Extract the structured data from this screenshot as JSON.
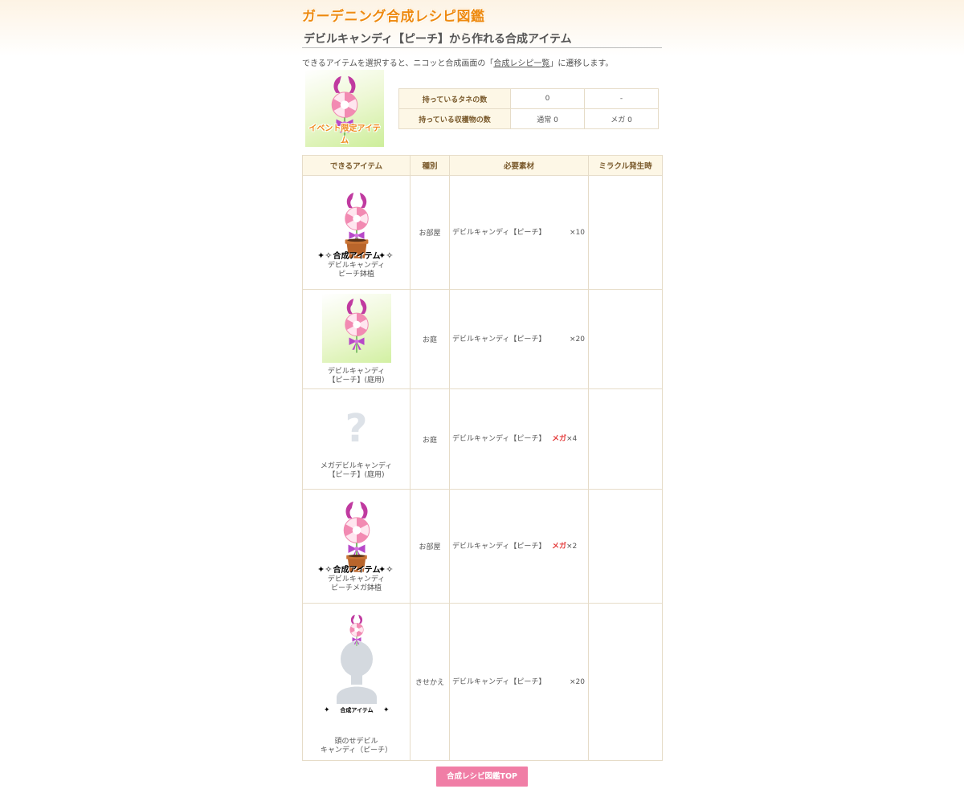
{
  "header": {
    "logo": "ガーデニング合成レシピ図鑑",
    "title": "デビルキャンディ【ピーチ】から作れる合成アイテム"
  },
  "intro": {
    "before": "できるアイテムを選択すると、ニコッと合成画面の「",
    "link": "合成レシピ一覧",
    "after": "」に遷移します。"
  },
  "seed": {
    "event_label": "イベント限定アイテム"
  },
  "possession": {
    "rows": [
      {
        "label": "持っているタネの数",
        "v1": "0",
        "v2": "-"
      },
      {
        "label": "持っている収穫物の数",
        "v1": "通常 0",
        "v2": "メガ 0"
      }
    ]
  },
  "table": {
    "headers": [
      "できるアイテム",
      "種別",
      "必要素材",
      "ミラクル発生時"
    ],
    "rows": [
      {
        "name1": "デビルキャンディ",
        "name2": "ピーチ鉢植",
        "kind": "お部屋",
        "material": "デビルキャンディ【ピーチ】",
        "mega": "",
        "qty": "×10",
        "miracle": ""
      },
      {
        "name1": "デビルキャンディ",
        "name2": "【ピーチ】(庭用)",
        "kind": "お庭",
        "material": "デビルキャンディ【ピーチ】",
        "mega": "",
        "qty": "×20",
        "miracle": ""
      },
      {
        "name1": "メガデビルキャンディ",
        "name2": "【ピーチ】(庭用)",
        "kind": "お庭",
        "material": "デビルキャンディ【ピーチ】",
        "mega": "メガ",
        "qty": "×4",
        "miracle": ""
      },
      {
        "name1": "デビルキャンディ",
        "name2": "ピーチメガ鉢植",
        "kind": "お部屋",
        "material": "デビルキャンディ【ピーチ】",
        "mega": "メガ",
        "qty": "×2",
        "miracle": ""
      },
      {
        "name1": "頭のせデビル",
        "name2": "キャンディ（ピーチ）",
        "kind": "きせかえ",
        "material": "デビルキャンディ【ピーチ】",
        "mega": "",
        "qty": "×20",
        "miracle": ""
      }
    ],
    "gousei_label": "合成アイテム",
    "unknown_mark": "?"
  },
  "footer": {
    "top_button": "合成レシピ図鑑TOP"
  },
  "colors": {
    "accent_orange": "#ee8a10",
    "header_bg": "#fdf7e6",
    "border": "#e6dcc8",
    "mega_red": "#e43a3a",
    "button_pink": "#f07ea6"
  }
}
